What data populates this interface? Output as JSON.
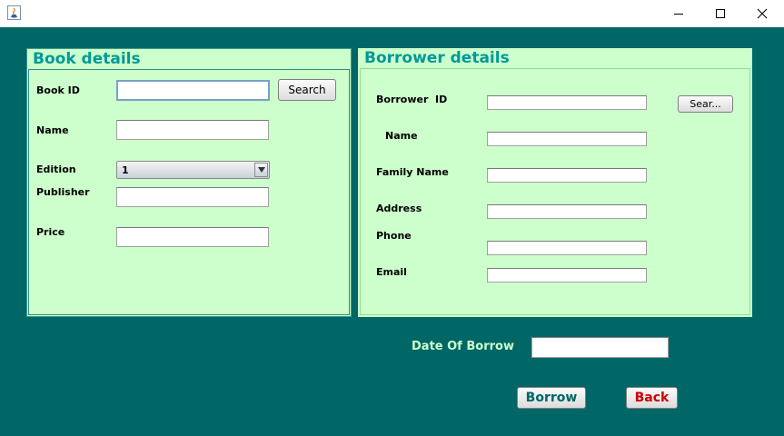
{
  "window": {
    "icon": "java-icon",
    "controls": {
      "minimize": "minimize-icon",
      "maximize": "maximize-icon",
      "close": "close-icon"
    }
  },
  "colors": {
    "background": "#006666",
    "panel": "#ccffcc",
    "panel_title": "#009999",
    "borrow_text": "#006666",
    "back_text": "#cc0000",
    "date_label": "#ccffcc"
  },
  "book_panel": {
    "title": "Book details",
    "book_id_label": "Book ID",
    "book_id_value": "",
    "search_button": "Search",
    "name_label": "Name",
    "name_value": "",
    "edition_label": "Edition",
    "edition_selected": "1",
    "publisher_label": "Publisher",
    "publisher_value": "",
    "price_label": "Price",
    "price_value": ""
  },
  "borrower_panel": {
    "title": "Borrower details",
    "borrower_id_label": "Borrower  ID",
    "borrower_id_value": "",
    "search_button": "Sear...",
    "name_label": "Name",
    "name_value": "",
    "family_name_label": "Family Name",
    "family_name_value": "",
    "address_label": "Address",
    "address_value": "",
    "phone_label": "Phone",
    "phone_value": "",
    "email_label": "Email",
    "email_value": ""
  },
  "footer": {
    "date_label": "Date Of Borrow",
    "date_value": "",
    "borrow_button": "Borrow",
    "back_button": "Back"
  }
}
